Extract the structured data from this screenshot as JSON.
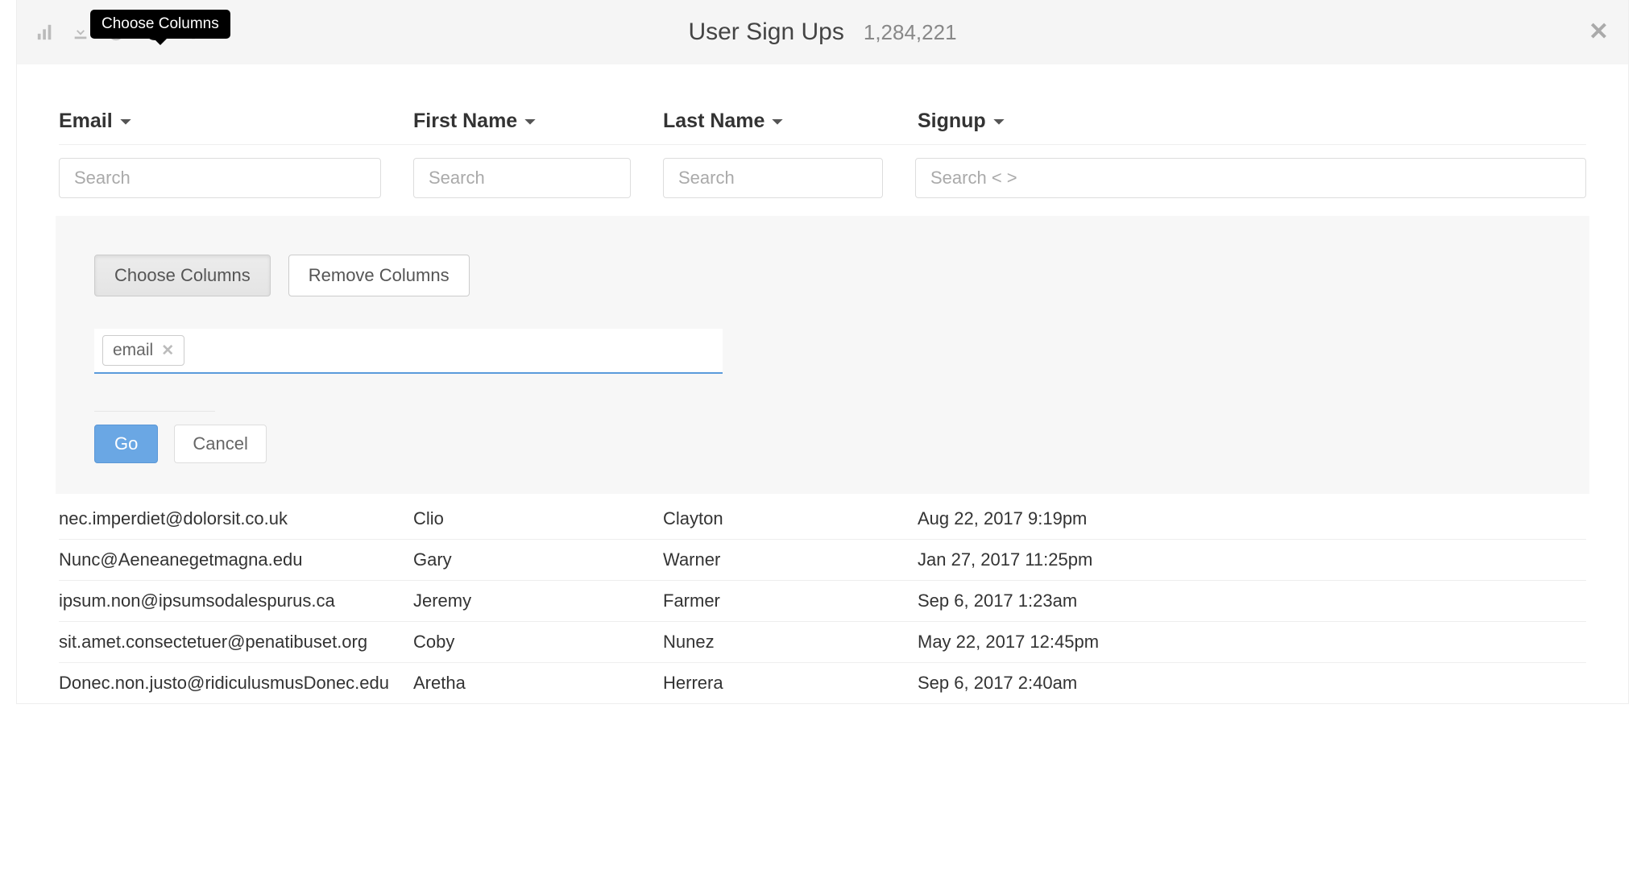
{
  "tooltip": "Choose Columns",
  "header": {
    "title": "User Sign Ups",
    "count": "1,284,221"
  },
  "columns": [
    {
      "key": "email",
      "label": "Email",
      "placeholder": "Search"
    },
    {
      "key": "first",
      "label": "First Name",
      "placeholder": "Search"
    },
    {
      "key": "last",
      "label": "Last Name",
      "placeholder": "Search"
    },
    {
      "key": "signup",
      "label": "Signup",
      "placeholder": "Search < >"
    }
  ],
  "panel": {
    "tabs": {
      "choose": "Choose Columns",
      "remove": "Remove Columns",
      "active": "choose"
    },
    "tag": "email",
    "go": "Go",
    "cancel": "Cancel"
  },
  "rows": [
    {
      "email": "nec.imperdiet@dolorsit.co.uk",
      "first": "Clio",
      "last": "Clayton",
      "signup": "Aug 22, 2017 9:19pm"
    },
    {
      "email": "Nunc@Aeneanegetmagna.edu",
      "first": "Gary",
      "last": "Warner",
      "signup": "Jan 27, 2017 11:25pm"
    },
    {
      "email": "ipsum.non@ipsumsodalespurus.ca",
      "first": "Jeremy",
      "last": "Farmer",
      "signup": "Sep 6, 2017 1:23am"
    },
    {
      "email": "sit.amet.consectetuer@penatibuset.org",
      "first": "Coby",
      "last": "Nunez",
      "signup": "May 22, 2017 12:45pm"
    },
    {
      "email": "Donec.non.justo@ridiculusmusDonec.edu",
      "first": "Aretha",
      "last": "Herrera",
      "signup": "Sep 6, 2017 2:40am"
    }
  ]
}
